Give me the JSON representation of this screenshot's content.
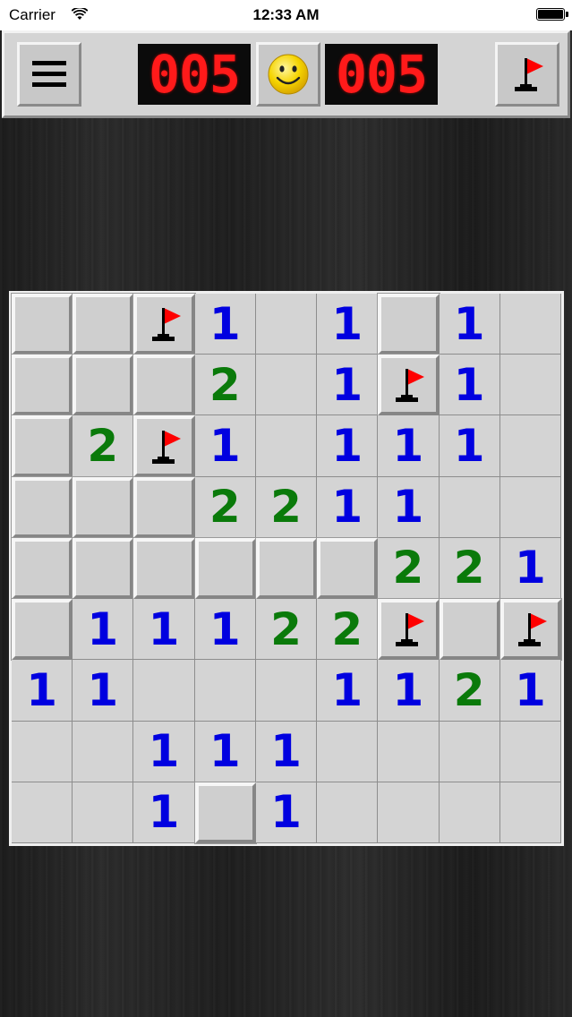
{
  "status_bar": {
    "carrier": "Carrier",
    "time": "12:33 AM"
  },
  "toolbar": {
    "mines_counter": "005",
    "timer": "005",
    "menu_icon": "hamburger-icon",
    "face_icon": "smiley-face-icon",
    "flag_icon": "flag-icon"
  },
  "colors": {
    "number_1": "#0000e0",
    "number_2": "#0a7a0a",
    "flag": "#ff0000",
    "lcd_text": "#ff1a1a"
  },
  "board": {
    "rows": 9,
    "cols": 9,
    "cells": [
      [
        "C",
        "C",
        "F",
        "1",
        "",
        "1",
        "C",
        "1",
        ""
      ],
      [
        "C",
        "C",
        "C",
        "2",
        "",
        "1",
        "F",
        "1",
        ""
      ],
      [
        "C",
        "2",
        "F",
        "1",
        "",
        "1",
        "1",
        "1",
        ""
      ],
      [
        "C",
        "C",
        "C",
        "2",
        "2",
        "1",
        "1",
        "",
        ""
      ],
      [
        "C",
        "C",
        "C",
        "C",
        "C",
        "C",
        "2",
        "2",
        "1"
      ],
      [
        "C",
        "1",
        "1",
        "1",
        "2",
        "2",
        "F",
        "C",
        "F"
      ],
      [
        "1",
        "1",
        "",
        "",
        "",
        "1",
        "1",
        "2",
        "1"
      ],
      [
        "",
        "",
        "1",
        "1",
        "1",
        "",
        "",
        "",
        ""
      ],
      [
        "",
        "",
        "1",
        "C",
        "1",
        "",
        "",
        "",
        ""
      ]
    ]
  }
}
